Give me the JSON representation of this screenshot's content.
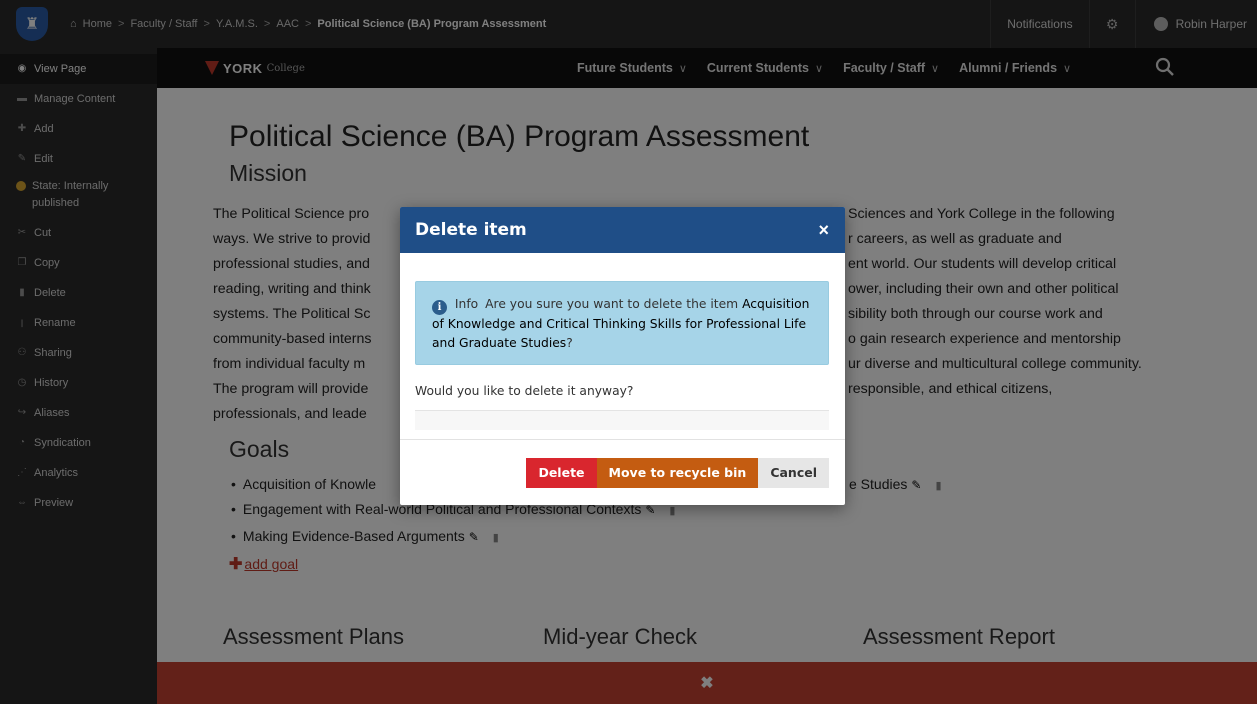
{
  "cms": {
    "breadcrumb": [
      "Home",
      "Faculty / Staff",
      "Y.A.M.S.",
      "AAC",
      "Political Science (BA) Program Assessment"
    ],
    "separator": ">",
    "notifications_label": "Notifications",
    "user_name": "Robin Harper"
  },
  "sidebar": {
    "items": [
      {
        "label": "View Page",
        "icon": "eye-icon"
      },
      {
        "label": "Manage Content",
        "icon": "folder-icon"
      },
      {
        "label": "Add",
        "icon": "plus-icon"
      },
      {
        "label": "Edit",
        "icon": "pencil-icon"
      },
      {
        "label": "State: Internally published",
        "icon": "state-dot-icon"
      },
      {
        "label": "Cut",
        "icon": "scissors-icon"
      },
      {
        "label": "Copy",
        "icon": "copy-icon"
      },
      {
        "label": "Delete",
        "icon": "trash-icon"
      },
      {
        "label": "Rename",
        "icon": "rename-icon"
      },
      {
        "label": "Sharing",
        "icon": "share-icon"
      },
      {
        "label": "History",
        "icon": "history-icon"
      },
      {
        "label": "Aliases",
        "icon": "alias-icon"
      },
      {
        "label": "Syndication",
        "icon": "rss-icon"
      },
      {
        "label": "Analytics",
        "icon": "analytics-icon"
      },
      {
        "label": "Preview",
        "icon": "preview-icon"
      }
    ]
  },
  "site_nav": {
    "logo_word": "YORK",
    "logo_suffix": "College",
    "links": [
      "Future Students",
      "Current Students",
      "Faculty / Staff",
      "Alumni / Friends"
    ]
  },
  "page": {
    "title": "Political Science (BA) Program Assessment",
    "mission_heading": "Mission",
    "mission_lines": [
      "The Political Science pro",
      "ways. We strive to provid",
      "professional studies, and",
      "reading, writing and think",
      "systems. The Political Sc",
      "community-based interns",
      "from individual faculty m",
      "The program will provide",
      "professionals, and leade"
    ],
    "mission_lines_right": [
      "Sciences and York College in the following",
      "r careers, as well as graduate and",
      "ent world. Our students will develop critical",
      "ower, including their own and other political",
      "sibility both through our course work and",
      "o gain research experience and mentorship",
      "ur diverse and multicultural college community.",
      "responsible, and ethical citizens,",
      ""
    ],
    "goals_heading": "Goals",
    "goals": [
      "Acquisition of Knowle",
      "Engagement with Real-world Political and Professional Contexts",
      "Making Evidence-Based Arguments"
    ],
    "goal1_tail": "e Studies",
    "add_goal": "add goal",
    "bottom_headings": [
      "Assessment Plans",
      "Mid-year Check",
      "Assessment Report"
    ]
  },
  "modal": {
    "title": "Delete item",
    "close_symbol": "×",
    "info_label": "Info",
    "info_text_prefix": "Are you sure you want to delete the item",
    "item_name": "Acquisition of Knowledge and Critical Thinking Skills for Professional Life and Graduate Studies",
    "info_text_suffix": "?",
    "question": "Would you like to delete it anyway?",
    "buttons": {
      "delete": "Delete",
      "recycle": "Move to recycle bin",
      "cancel": "Cancel"
    }
  }
}
